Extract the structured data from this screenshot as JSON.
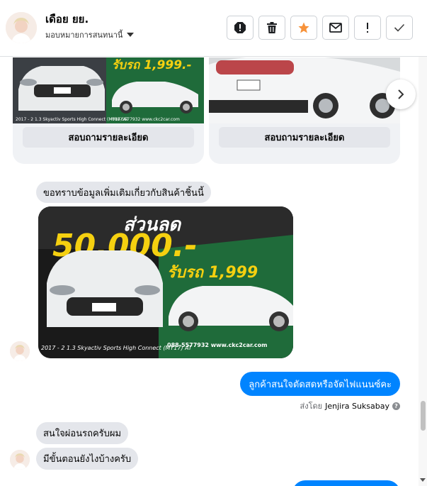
{
  "header": {
    "contact_name": "เดือย ยย.",
    "assign_label": "มอบหมายการสนทนานี้",
    "actions": [
      {
        "name": "spam-icon",
        "label": "!"
      },
      {
        "name": "trash-icon",
        "label": ""
      },
      {
        "name": "star-icon",
        "label": "★"
      },
      {
        "name": "mail-icon",
        "label": ""
      },
      {
        "name": "exclamation-icon",
        "label": "!"
      },
      {
        "name": "check-icon",
        "label": "✓"
      }
    ]
  },
  "carousel": {
    "cards": [
      {
        "button_label": "สอบถามรายละเอียด",
        "promo_text": "รับรถ 1,999.-",
        "caption": "2017 - 2 1.3 Skyactiv Sports High Connect (MY17) AT",
        "phone": "088-5577932 www.ckc2car.com"
      },
      {
        "button_label": "สอบถามรายละเอียด"
      }
    ]
  },
  "messages": {
    "incoming_question": "ขอทราบข้อมูลเพิ่มเติมเกี่ยวกับสินค้าชิ้นนี้",
    "photo": {
      "headline": "ส่วนลด",
      "amount": "50,000.-",
      "promo": "รับรถ 1,999",
      "caption": "2017 - 2 1.3 Skyactiv Sports High Connect (MY17) AT",
      "phone": "088-5577932 www.ckc2car.com"
    },
    "outgoing_reply": "ลูกค้าสนใจตัดสดหรือจัดไฟแนนซ์คะ",
    "sent_by_prefix": "ส่งโดย",
    "sent_by_name": "Jenjira Suksabay",
    "incoming_2": "สนใจผ่อนรถครับผม",
    "incoming_3": "มีขั้นตอนยังไงบ้างครับ"
  },
  "colors": {
    "outgoing_bubble": "#0084ff",
    "incoming_bubble": "#e4e6eb",
    "star": "#f7923a",
    "promo_yellow": "#f5d010",
    "promo_green": "#1f6b3a"
  }
}
